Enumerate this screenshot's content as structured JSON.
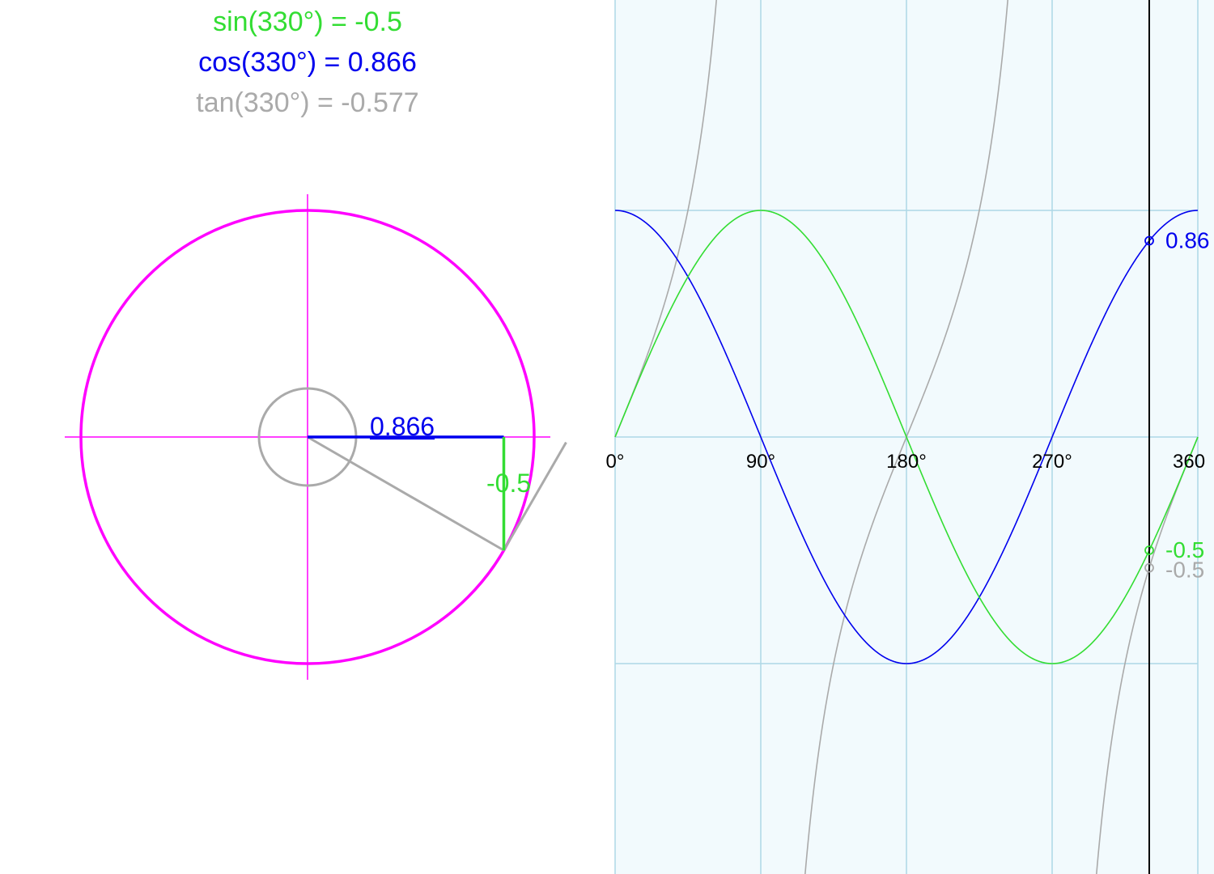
{
  "readouts": {
    "sin": "sin(330°) = -0.5",
    "cos": "cos(330°) = 0.866",
    "tan": "tan(330°) = -0.577"
  },
  "circle_labels": {
    "cos_value": "0.866",
    "sin_value": "-0.5"
  },
  "colors": {
    "sin": "#33dd33",
    "cos": "#0000ee",
    "tan": "#aaaaaa",
    "unit_circle": "#ff00ff",
    "grid": "#add8e6",
    "plot_background": "#f2fafd",
    "cursor": "#000000"
  },
  "chart_data": [
    {
      "type": "diagram",
      "angle_deg": 330,
      "values": {
        "sin": -0.5,
        "cos": 0.866,
        "tan": -0.577
      }
    },
    {
      "type": "line",
      "x_ticks": [
        "0°",
        "90°",
        "180°",
        "270°",
        "360"
      ],
      "xlim": [
        0,
        360
      ],
      "ylim": [
        -1.93,
        1.93
      ],
      "cursor_x": 330,
      "series": [
        {
          "key": "sin",
          "color": "#33dd33",
          "function": "sin",
          "marker_label": "-0.5"
        },
        {
          "key": "cos",
          "color": "#0000ee",
          "function": "cos",
          "marker_label": "0.86"
        },
        {
          "key": "tan",
          "color": "#aaaaaa",
          "function": "tan",
          "marker_label": "-0.5"
        }
      ]
    }
  ]
}
